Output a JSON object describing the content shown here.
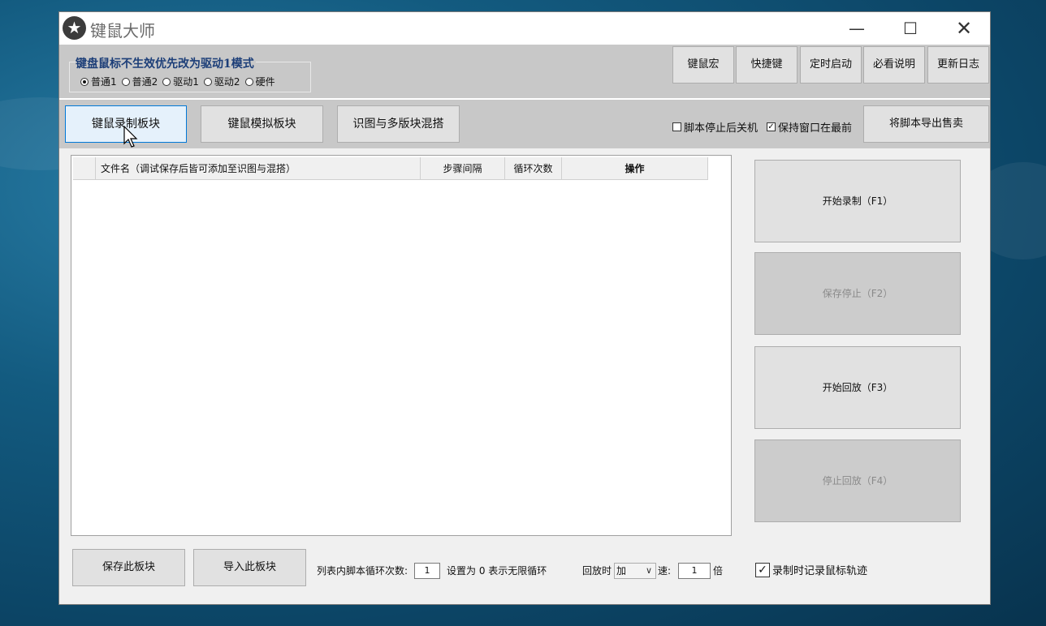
{
  "window": {
    "title": "键鼠大师"
  },
  "toolbar": {
    "mode_title": "键盘鼠标不生效优先改为驱动1模式",
    "modes": [
      {
        "label": "普通1",
        "selected": true
      },
      {
        "label": "普通2",
        "selected": false
      },
      {
        "label": "驱动1",
        "selected": false
      },
      {
        "label": "驱动2",
        "selected": false
      },
      {
        "label": "硬件",
        "selected": false
      }
    ],
    "buttons": [
      "键鼠宏",
      "快捷键",
      "定时启动",
      "必看说明",
      "更新日志"
    ]
  },
  "tabs": {
    "items": [
      "键鼠录制板块",
      "键鼠模拟板块",
      "识图与多版块混搭"
    ],
    "active": "键鼠录制板块",
    "shutdown_label": "脚本停止后关机",
    "shutdown_checked": false,
    "topmost_label": "保持窗口在最前",
    "topmost_checked": true,
    "export_label": "将脚本导出售卖"
  },
  "list": {
    "columns": [
      "",
      "文件名（调试保存后皆可添加至识图与混搭）",
      "步骤间隔",
      "循环次数",
      "操作"
    ],
    "rows": []
  },
  "side": {
    "start_record": "开始录制（F1）",
    "save_stop": "保存停止（F2）",
    "start_play": "开始回放（F3）",
    "stop_play": "停止回放（F4）"
  },
  "bottom": {
    "save_label": "保存此板块",
    "import_label": "导入此板块",
    "loop_label": "列表内脚本循环次数:",
    "loop_value": "1",
    "loop_hint": "设置为 0 表示无限循环",
    "play_label": "回放时",
    "speed_mode": "加",
    "speed_label": "速:",
    "speed_value": "1",
    "speed_unit": "倍",
    "track_label": "录制时记录鼠标轨迹",
    "track_checked": true
  },
  "colors": {
    "accent": "#0078d7",
    "title_blue": "#1c3e78",
    "toolbar_bg": "#c8c8c8"
  }
}
